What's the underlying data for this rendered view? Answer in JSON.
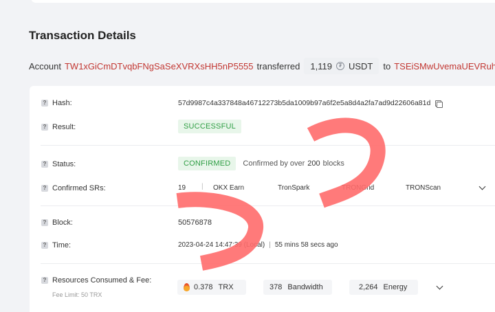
{
  "title": "Transaction Details",
  "summary": {
    "prefix": "Account",
    "from_address": "TW1xGiCmDTvqbFNgSaSeXVRXsHH5nP5555",
    "verb": "transferred",
    "amount": "1,119",
    "token_icon": "usdt-icon",
    "token": "USDT",
    "to_word": "to",
    "to_address": "TSEiSMwUvemaUEVRuh"
  },
  "details": {
    "hash": {
      "label": "Hash:",
      "value": "57d9987c4a337848a46712273b5da1009b97a6f2e5a8d4a2fa7ad9d22606a81d"
    },
    "result": {
      "label": "Result:",
      "value": "SUCCESSFUL"
    },
    "status": {
      "label": "Status:",
      "value": "CONFIRMED",
      "note_prefix": "Confirmed by over",
      "note_count": "200",
      "note_suffix": "blocks"
    },
    "confirmed_srs": {
      "label": "Confirmed SRs:",
      "count": "19",
      "items": [
        "OKX Earn",
        "TronSpark",
        "TRONGrid",
        "TRONScan"
      ]
    },
    "block": {
      "label": "Block:",
      "value": "50576878"
    },
    "time": {
      "label": "Time:",
      "value": "2023-04-24 14:47:39 (Local)",
      "separator": "|",
      "ago": "55 mins 58 secs ago"
    },
    "resources": {
      "label": "Resources Consumed & Fee:",
      "fee_limit": "Fee Limit: 50 TRX",
      "trx_amount": "0.378",
      "trx_unit": "TRX",
      "bandwidth_amount": "378",
      "bandwidth_unit": "Bandwidth",
      "energy_amount": "2,264",
      "energy_unit": "Energy"
    }
  },
  "colors": {
    "address": "#c23631",
    "success_bg": "#e8f6ea",
    "success_text": "#2f9e44",
    "scribble": "#ff6b6b"
  },
  "help_icon": "question-mark-icon"
}
